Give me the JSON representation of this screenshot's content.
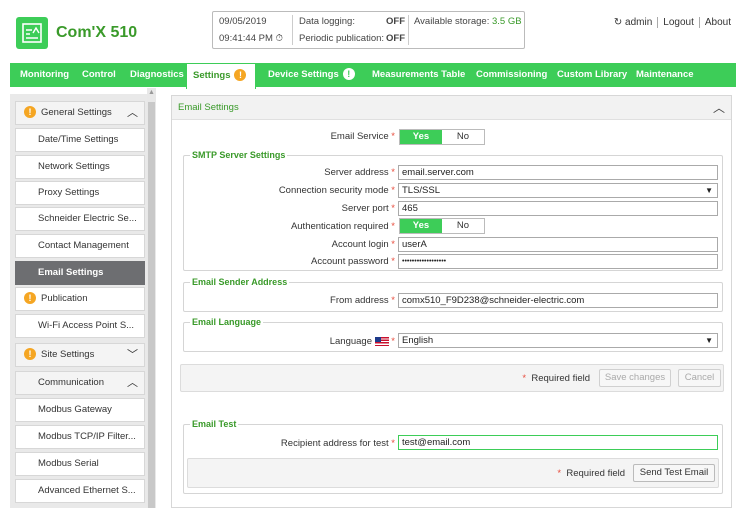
{
  "header": {
    "title": "Com'X 510",
    "date": "09/05/2019",
    "time": "09:41:44 PM",
    "data_logging_label": "Data logging:",
    "data_logging_value": "OFF",
    "periodic_publication_label": "Periodic publication:",
    "periodic_publication_value": "OFF",
    "storage_label": "Available storage:",
    "storage_value": "3.5 GB",
    "user": "admin",
    "logout": "Logout",
    "about": "About"
  },
  "nav": {
    "tabs": [
      {
        "label": "Monitoring"
      },
      {
        "label": "Control"
      },
      {
        "label": "Diagnostics"
      },
      {
        "label": "Settings",
        "active": true
      },
      {
        "label": "Device Settings"
      },
      {
        "label": "Measurements Table"
      },
      {
        "label": "Commissioning"
      },
      {
        "label": "Custom Library"
      },
      {
        "label": "Maintenance"
      }
    ]
  },
  "sidebar": {
    "items": [
      {
        "label": "General Settings",
        "type": "group"
      },
      {
        "label": "Date/Time Settings"
      },
      {
        "label": "Network Settings"
      },
      {
        "label": "Proxy Settings"
      },
      {
        "label": "Schneider Electric Se..."
      },
      {
        "label": "Contact Management"
      },
      {
        "label": "Email Settings",
        "active": true
      },
      {
        "label": "Publication",
        "type": "group"
      },
      {
        "label": "Wi-Fi Access Point S..."
      },
      {
        "label": "Site Settings",
        "type": "group"
      },
      {
        "label": "Communication",
        "type": "group"
      },
      {
        "label": "Modbus Gateway"
      },
      {
        "label": "Modbus TCP/IP Filter..."
      },
      {
        "label": "Modbus Serial"
      },
      {
        "label": "Advanced Ethernet S..."
      }
    ]
  },
  "main": {
    "panel_title": "Email Settings",
    "email_service_label": "Email Service",
    "yes": "Yes",
    "no": "No",
    "smtp": {
      "legend": "SMTP Server Settings",
      "server_address_label": "Server address",
      "server_address": "email.server.com",
      "security_mode_label": "Connection security mode",
      "security_mode": "TLS/SSL",
      "port_label": "Server port",
      "port": "465",
      "auth_label": "Authentication required",
      "login_label": "Account login",
      "login": "userA",
      "password_label": "Account password",
      "password": "••••••••••••••••••"
    },
    "sender": {
      "legend": "Email Sender Address",
      "from_label": "From address",
      "from": "comx510_F9D238@schneider-electric.com"
    },
    "language": {
      "legend": "Email Language",
      "label": "Language",
      "value": "English"
    },
    "required_field": "Required field",
    "save_changes": "Save changes",
    "cancel": "Cancel",
    "test": {
      "legend": "Email Test",
      "recipient_label": "Recipient address for test",
      "recipient": "test@email.com",
      "send_button": "Send Test Email"
    },
    "required_mark": "*"
  },
  "colors": {
    "brand_green": "#3dcd58",
    "text_green": "#3a9a2a",
    "warning_orange": "#f5a623",
    "off_orange": "#e85a00",
    "required_red": "#e84c3d"
  }
}
